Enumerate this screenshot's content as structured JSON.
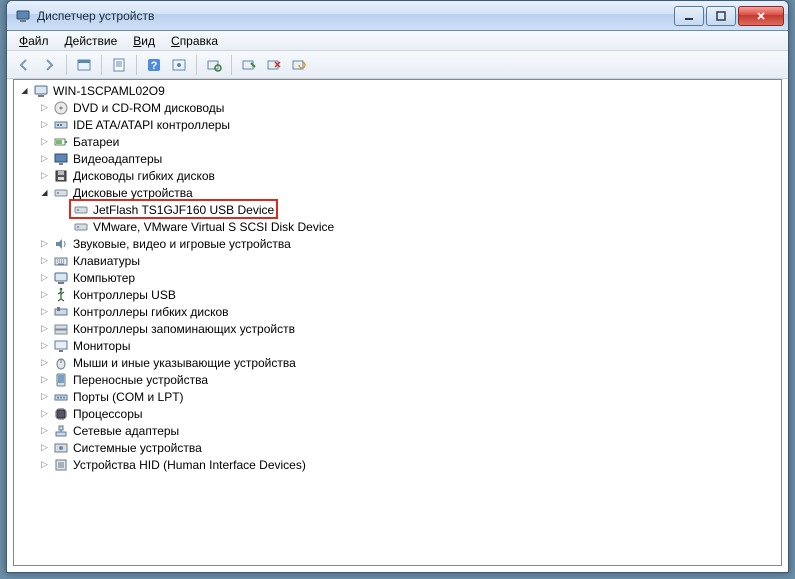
{
  "window": {
    "title": "Диспетчер устройств"
  },
  "menu": {
    "file": "Файл",
    "action": "Действие",
    "view": "Вид",
    "help": "Справка"
  },
  "toolbar_icons": [
    "back-icon",
    "forward-icon",
    "sep",
    "show-hidden-icon",
    "sep",
    "properties-icon",
    "sep",
    "help-icon",
    "refresh-icon",
    "sep",
    "details-icon",
    "sep",
    "scan-icon",
    "uninstall-icon",
    "update-icon"
  ],
  "tree": {
    "root": {
      "label": "WIN-1SCPAML02O9",
      "expanded": true,
      "icon": "computer-icon"
    },
    "categories": [
      {
        "label": "DVD и CD-ROM дисководы",
        "icon": "disc-icon",
        "expanded": false
      },
      {
        "label": "IDE ATA/ATAPI контроллеры",
        "icon": "controller-icon",
        "expanded": false
      },
      {
        "label": "Батареи",
        "icon": "battery-icon",
        "expanded": false
      },
      {
        "label": "Видеоадаптеры",
        "icon": "display-icon",
        "expanded": false
      },
      {
        "label": "Дисководы гибких дисков",
        "icon": "floppy-icon",
        "expanded": false
      },
      {
        "label": "Дисковые устройства",
        "icon": "drive-icon",
        "expanded": true,
        "children": [
          {
            "label": "JetFlash TS1GJF160 USB Device",
            "icon": "drive-icon",
            "highlighted": true
          },
          {
            "label": "VMware, VMware Virtual S SCSI Disk Device",
            "icon": "drive-icon"
          }
        ]
      },
      {
        "label": "Звуковые, видео и игровые устройства",
        "icon": "sound-icon",
        "expanded": false
      },
      {
        "label": "Клавиатуры",
        "icon": "keyboard-icon",
        "expanded": false
      },
      {
        "label": "Компьютер",
        "icon": "computer-icon",
        "expanded": false
      },
      {
        "label": "Контроллеры USB",
        "icon": "usb-icon",
        "expanded": false
      },
      {
        "label": "Контроллеры гибких дисков",
        "icon": "floppyctrl-icon",
        "expanded": false
      },
      {
        "label": "Контроллеры запоминающих устройств",
        "icon": "storage-icon",
        "expanded": false
      },
      {
        "label": "Мониторы",
        "icon": "monitor-icon",
        "expanded": false
      },
      {
        "label": "Мыши и иные указывающие устройства",
        "icon": "mouse-icon",
        "expanded": false
      },
      {
        "label": "Переносные устройства",
        "icon": "portable-icon",
        "expanded": false
      },
      {
        "label": "Порты (COM и LPT)",
        "icon": "port-icon",
        "expanded": false
      },
      {
        "label": "Процессоры",
        "icon": "cpu-icon",
        "expanded": false
      },
      {
        "label": "Сетевые адаптеры",
        "icon": "network-icon",
        "expanded": false
      },
      {
        "label": "Системные устройства",
        "icon": "system-icon",
        "expanded": false
      },
      {
        "label": "Устройства HID (Human Interface Devices)",
        "icon": "hid-icon",
        "expanded": false
      }
    ]
  }
}
